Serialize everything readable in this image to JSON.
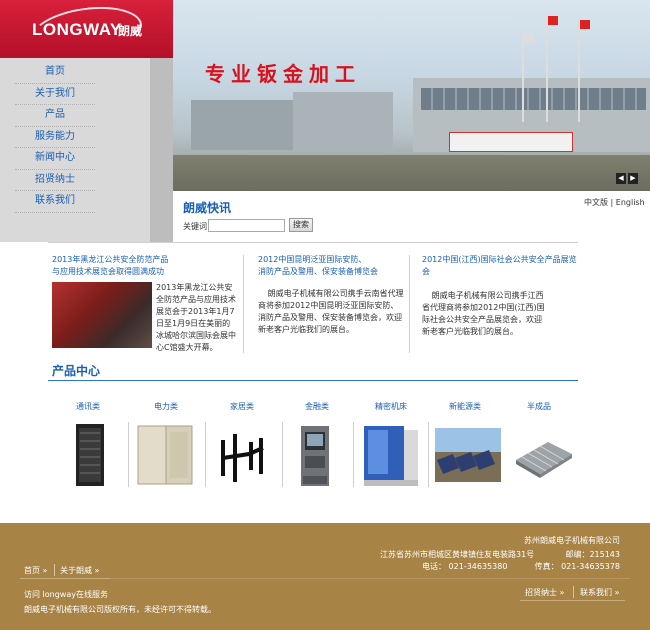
{
  "brand": {
    "logo_text": "LONGWAY",
    "logo_cn": "朗威"
  },
  "nav": {
    "items": [
      {
        "label": "首页"
      },
      {
        "label": "关于我们"
      },
      {
        "label": "产品"
      },
      {
        "label": "服务能力"
      },
      {
        "label": "新闻中心"
      },
      {
        "label": "招贤纳士"
      },
      {
        "label": "联系我们"
      }
    ]
  },
  "banner": {
    "title": "专业钣金加工",
    "prev": "◀",
    "next": "▶"
  },
  "quick_news": {
    "title": "朗威快讯",
    "lang": "中文版 | English",
    "search_label": "关键词",
    "search_value": "",
    "search_button": "搜索"
  },
  "news": [
    {
      "title_line1": "2013年黑龙江公共安全防范产品",
      "title_line2": "与应用技术展览会取得圆满成功",
      "body": "2013年黑龙江公共安全防范产品与应用技术展览会于2013年1月7日至1月9日在美丽的冰城哈尔滨国际会展中心C馆盛大开幕。"
    },
    {
      "title_line1": "2012中国昆明泛亚国际安防、",
      "title_line2": "消防产品及警用、保安装备博览会",
      "body": "朗威电子机械有限公司携手云南省代理商将参加2012中国昆明泛亚国际安防、消防产品及警用、保安装备博览会，欢迎新老客户光临我们的展台。"
    },
    {
      "title_line1": "2012中国(江西)国际社会公共安全产品展览会",
      "title_line2": "",
      "body": "朗威电子机械有限公司携手江西省代理商将参加2012中国(江西)国际社会公共安全产品展览会，欢迎新老客户光临我们的展台。"
    }
  ],
  "products": {
    "title": "产品中心",
    "categories": [
      "通讯类",
      "电力类",
      "家居类",
      "金融类",
      "精密机床",
      "新能源类",
      "半成品"
    ]
  },
  "footer": {
    "company": "苏州朗威电子机械有限公司",
    "address": "江苏省苏州市相城区黄埭镇住友电装路31号",
    "postcode": "邮编：215143",
    "tel": "电话： 021-34635380",
    "fax": "传真： 021-34635378",
    "links_left": [
      "首页 »",
      "关于朗威 »"
    ],
    "visit": "访问  longway在线服务",
    "links_right": [
      "招贤纳士 »",
      "联系我们 »"
    ],
    "copyright": "朗威电子机械有限公司版权所有，未经许可不得转载。"
  }
}
